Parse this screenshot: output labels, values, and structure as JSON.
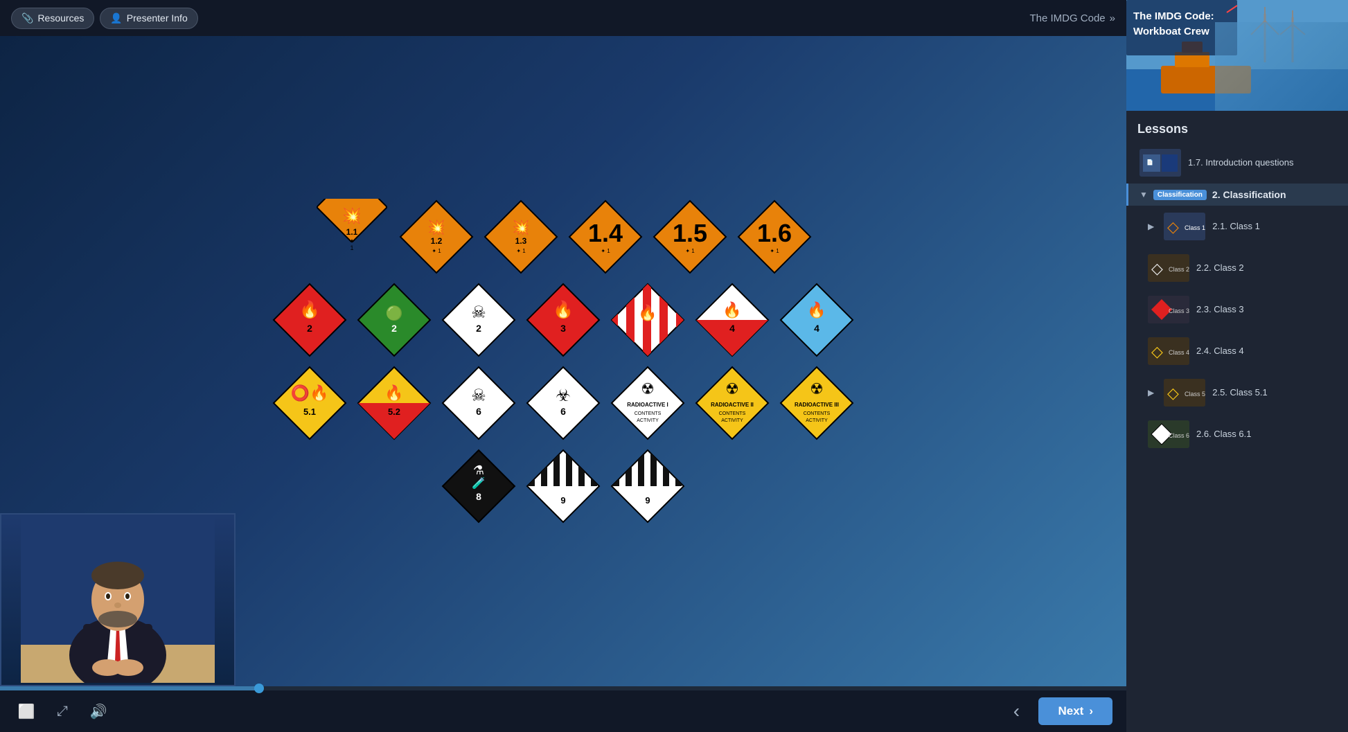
{
  "app": {
    "title": "The IMDG Code: Workboat Crew"
  },
  "topbar": {
    "resources_label": "Resources",
    "presenter_info_label": "Presenter Info",
    "breadcrumb": "The IMDG Code",
    "breadcrumb_arrow": "»"
  },
  "controls": {
    "captions_label": "CC",
    "fullscreen_label": "⛶",
    "volume_label": "🔊",
    "prev_label": "‹",
    "next_label": "Next",
    "next_arrow": "›"
  },
  "sidebar": {
    "lessons_header": "Lessons",
    "thumbnail_title": "The IMDG Code:\nWorkboat Crew",
    "lessons": [
      {
        "id": "intro",
        "title": "1.7. Introduction questions",
        "thumb_type": "intro"
      },
      {
        "id": "classification",
        "title": "2. Classification",
        "thumb_type": "classification",
        "active": true,
        "is_section": true
      },
      {
        "id": "class1",
        "title": "2.1. Class 1",
        "thumb_type": "class1",
        "expandable": true
      },
      {
        "id": "class2",
        "title": "2.2. Class 2",
        "thumb_type": "class2"
      },
      {
        "id": "class3",
        "title": "2.3. Class 3",
        "thumb_type": "class3"
      },
      {
        "id": "class4",
        "title": "2.4. Class 4",
        "thumb_type": "class4"
      },
      {
        "id": "class51",
        "title": "2.5. Class 5.1",
        "thumb_type": "class51",
        "expandable": true
      },
      {
        "id": "class61",
        "title": "2.6. Class 6.1",
        "thumb_type": "class61"
      }
    ]
  },
  "hazmat": {
    "row1": [
      {
        "label": "1.1",
        "color": "orange",
        "sublabel": "1"
      },
      {
        "label": "1.2",
        "color": "orange",
        "sublabel": "1"
      },
      {
        "label": "1.3",
        "color": "orange",
        "sublabel": "1"
      },
      {
        "label": "1.4",
        "color": "orange",
        "sublabel": "1"
      },
      {
        "label": "1.5",
        "color": "orange",
        "sublabel": "1"
      },
      {
        "label": "1.6",
        "color": "orange",
        "sublabel": "1"
      }
    ],
    "row2": [
      {
        "label": "2",
        "color": "red",
        "symbol": "flame"
      },
      {
        "label": "2",
        "color": "green",
        "symbol": "canister"
      },
      {
        "label": "2",
        "color": "white",
        "symbol": "skull"
      },
      {
        "label": "3",
        "color": "red",
        "symbol": "flame"
      },
      {
        "label": "",
        "color": "red-stripe",
        "symbol": "flame"
      },
      {
        "label": "4",
        "color": "half-red",
        "symbol": "flame"
      },
      {
        "label": "4",
        "color": "blue",
        "symbol": "flame-white"
      }
    ],
    "row3": [
      {
        "label": "5.1",
        "color": "yellow",
        "symbol": "flame-circle"
      },
      {
        "label": "5.2",
        "color": "yellow-red",
        "symbol": "flame"
      },
      {
        "label": "6",
        "color": "white",
        "symbol": "skull-crossbones"
      },
      {
        "label": "6",
        "color": "white",
        "symbol": "biohazard"
      },
      {
        "label": "RADIOACTIVE I",
        "color": "white",
        "symbol": "radioactive"
      },
      {
        "label": "RADIOACTIVE II",
        "color": "yellow",
        "symbol": "radioactive"
      },
      {
        "label": "RADIOACTIVE III",
        "color": "yellow",
        "symbol": "radioactive"
      }
    ],
    "row4": [
      {
        "label": "8",
        "color": "black",
        "symbol": "corrosive"
      },
      {
        "label": "9",
        "color": "stripe-black",
        "symbol": "stripes"
      },
      {
        "label": "9",
        "color": "stripe-black2",
        "symbol": "stripes2"
      }
    ]
  },
  "progress": {
    "percent": 23
  }
}
